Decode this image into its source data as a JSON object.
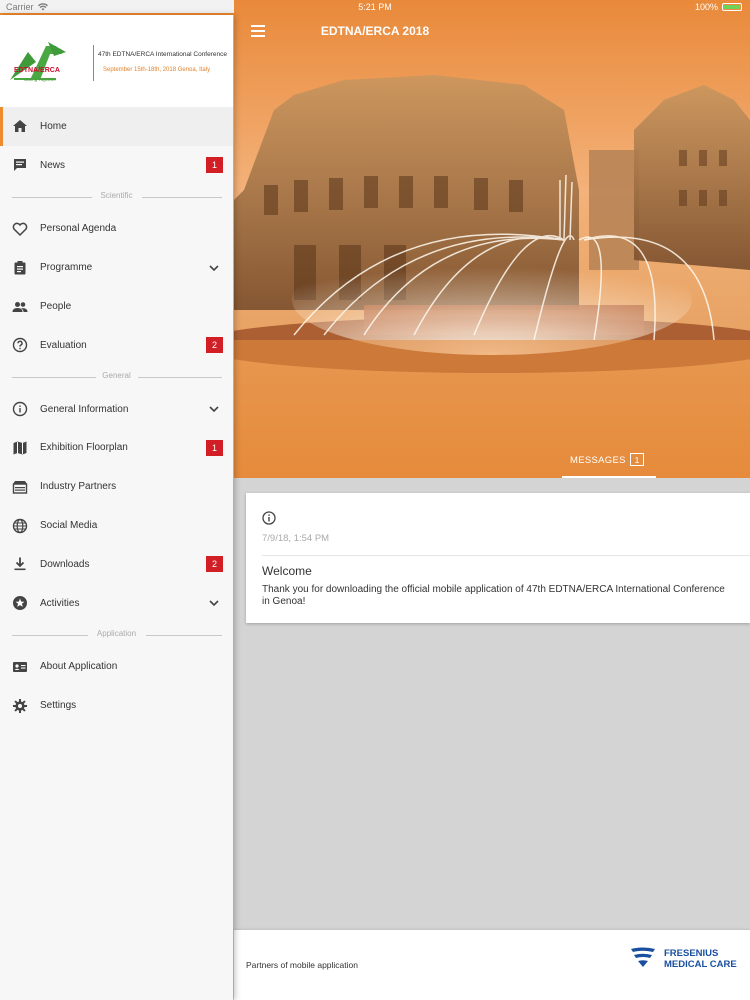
{
  "status": {
    "carrier": "Carrier",
    "time": "5:21 PM",
    "battery": "100%"
  },
  "logo": {
    "brand": "EDTNA/ERCA",
    "tagline": "Caring Together",
    "conference": "47th EDTNA/ERCA International Conference",
    "dates": "September 15th-18th, 2018 Genoa, Italy"
  },
  "nav": {
    "home": "Home",
    "news": {
      "label": "News",
      "badge": "1"
    },
    "section_scientific": "Scientific",
    "personal_agenda": "Personal Agenda",
    "programme": "Programme",
    "people": "People",
    "evaluation": {
      "label": "Evaluation",
      "badge": "2"
    },
    "section_general": "General",
    "general_information": "General Information",
    "exhibition": {
      "label": "Exhibition Floorplan",
      "badge": "1"
    },
    "industry_partners": "Industry Partners",
    "social_media": "Social Media",
    "downloads": {
      "label": "Downloads",
      "badge": "2"
    },
    "activities": "Activities",
    "section_application": "Application",
    "about": "About Application",
    "settings": "Settings"
  },
  "header": {
    "title": "EDTNA/ERCA 2018"
  },
  "tabs": {
    "messages": "MESSAGES",
    "messages_count": "1"
  },
  "message": {
    "date": "7/9/18, 1:54 PM",
    "title": "Welcome",
    "line1": "Thank you for downloading the official mobile application of 47th EDTNA/ERCA International Conference",
    "line2": "in Genoa!"
  },
  "footer": {
    "label": "Partners of mobile application",
    "partner_line1": "FRESENIUS",
    "partner_line2": "MEDICAL CARE"
  },
  "colors": {
    "accent": "#f08b2d",
    "badge": "#d21f26",
    "partner_blue": "#1a4fa0"
  }
}
